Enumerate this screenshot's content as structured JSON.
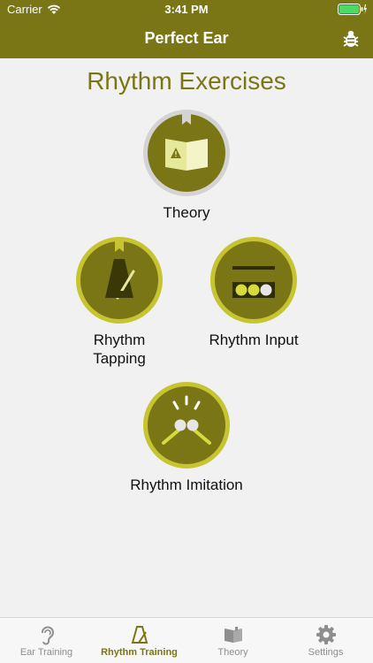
{
  "status_bar": {
    "carrier": "Carrier",
    "time": "3:41 PM"
  },
  "nav": {
    "title": "Perfect Ear",
    "right_icon": "bug-icon"
  },
  "page": {
    "title": "Rhythm Exercises"
  },
  "exercises": [
    {
      "label": "Theory",
      "icon": "book-icon"
    },
    {
      "label": "Rhythm\nTapping",
      "icon": "metronome-icon"
    },
    {
      "label": "Rhythm Input",
      "icon": "rhythm-input-icon"
    },
    {
      "label": "Rhythm Imitation",
      "icon": "imitation-icon"
    }
  ],
  "tabs": [
    {
      "label": "Ear Training",
      "icon": "ear-icon",
      "active": false
    },
    {
      "label": "Rhythm Training",
      "icon": "metronome-icon",
      "active": true
    },
    {
      "label": "Theory",
      "icon": "book-icon",
      "active": false
    },
    {
      "label": "Settings",
      "icon": "gear-icon",
      "active": false
    }
  ],
  "colors": {
    "accent": "#7b7615",
    "circle_fill": "#7b7615",
    "circle_ring": "#c6c431",
    "theory_ring": "#d3d3d3",
    "icon_light": "#e6e99b"
  }
}
